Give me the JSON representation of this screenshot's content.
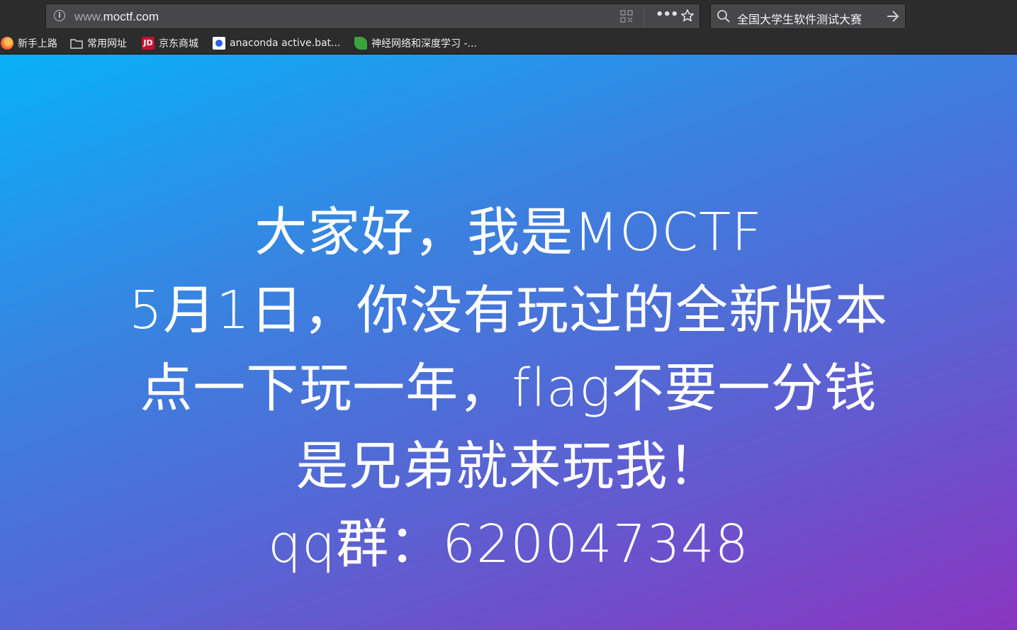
{
  "browser": {
    "url_prefix": "www.",
    "url_domain": "moctf.com",
    "search_text": "全国大学生软件测试大赛",
    "more_label": "•••"
  },
  "bookmarks": [
    {
      "label": "新手上路",
      "icon": "firefox-icon"
    },
    {
      "label": "常用网址",
      "icon": "folder-icon"
    },
    {
      "label": "京东商城",
      "icon": "jd-icon"
    },
    {
      "label": "anaconda active.bat...",
      "icon": "baidu-icon"
    },
    {
      "label": "神经网络和深度学习 -...",
      "icon": "leaf-icon"
    }
  ],
  "jd_icon_text": "JD",
  "page": {
    "lines": [
      "大家好，我是MOCTF",
      "5月1日，你没有玩过的全新版本",
      "点一下玩一年，flag不要一分钱",
      "是兄弟就来玩我！",
      "qq群：620047348"
    ],
    "gradient_colors": [
      "#09b0f8",
      "#8a35c2"
    ]
  }
}
